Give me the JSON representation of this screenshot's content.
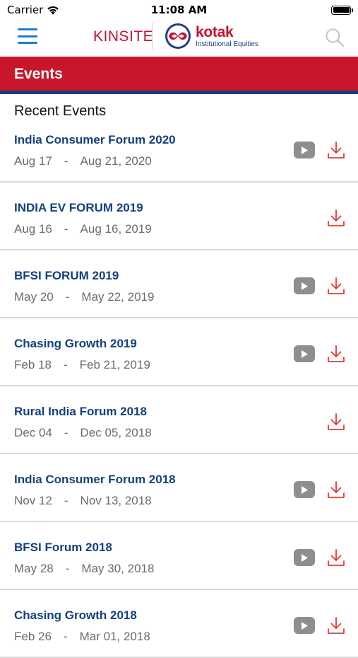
{
  "status_bar": {
    "carrier": "Carrier",
    "time": "11:08 AM"
  },
  "header": {
    "app_name": "KINSITE",
    "brand": "kotak",
    "brand_sub": "Institutional Equities",
    "brand_color": "#c8102e",
    "menu_icon": "hamburger-menu-icon",
    "search_icon": "search-icon"
  },
  "page": {
    "title": "Events",
    "title_bar_color": "#c8172b",
    "accent_stripe_color": "#1e3a7b",
    "section_heading": "Recent Events"
  },
  "events": [
    {
      "title": "India Consumer Forum 2020",
      "start": "Aug 17",
      "end": "Aug 21, 2020",
      "has_video": true
    },
    {
      "title": "INDIA EV FORUM 2019",
      "start": "Aug 16",
      "end": "Aug 16, 2019",
      "has_video": false
    },
    {
      "title": "BFSI FORUM 2019",
      "start": "May 20",
      "end": "May 22, 2019",
      "has_video": true
    },
    {
      "title": "Chasing Growth 2019",
      "start": "Feb 18",
      "end": "Feb 21, 2019",
      "has_video": true
    },
    {
      "title": "Rural India Forum 2018",
      "start": "Dec 04",
      "end": "Dec 05, 2018",
      "has_video": false
    },
    {
      "title": "India Consumer Forum 2018",
      "start": "Nov 12",
      "end": "Nov 13, 2018",
      "has_video": true
    },
    {
      "title": "BFSI Forum 2018",
      "start": "May 28",
      "end": "May 30, 2018",
      "has_video": true
    },
    {
      "title": "Chasing Growth 2018",
      "start": "Feb 26",
      "end": "Mar 01, 2018",
      "has_video": true
    }
  ],
  "date_separator": "-"
}
